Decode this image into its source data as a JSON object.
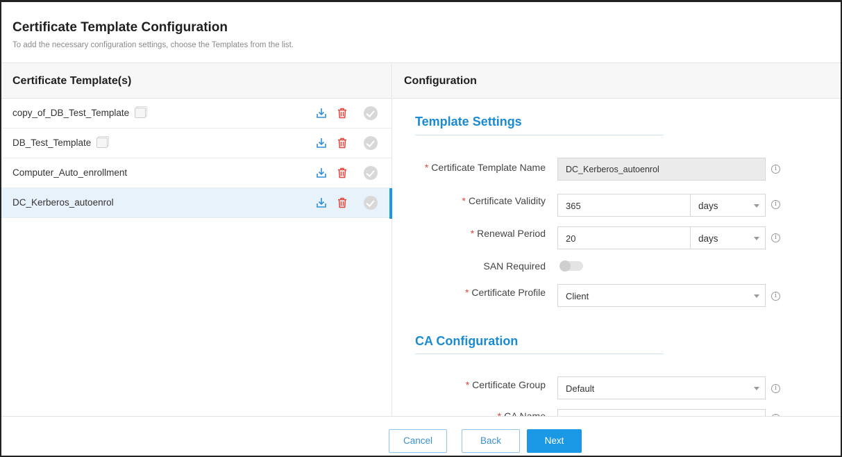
{
  "header": {
    "title": "Certificate Template Configuration",
    "subtitle": "To add the necessary configuration settings, choose the Templates from the list."
  },
  "template_list": {
    "heading": "Certificate Template(s)",
    "items": [
      {
        "name": "copy_of_DB_Test_Template",
        "has_copy_icon": true,
        "selected": false
      },
      {
        "name": "DB_Test_Template",
        "has_copy_icon": true,
        "selected": false
      },
      {
        "name": "Computer_Auto_enrollment",
        "has_copy_icon": false,
        "selected": false
      },
      {
        "name": "DC_Kerberos_autoenrol",
        "has_copy_icon": false,
        "selected": true
      }
    ],
    "row_icons": [
      "download-icon",
      "delete-icon",
      "check-circle-icon"
    ]
  },
  "configuration": {
    "heading": "Configuration",
    "template_settings": {
      "title": "Template Settings",
      "template_name_label": "Certificate Template Name",
      "template_name_value": "DC_Kerberos_autoenrol",
      "validity_label": "Certificate Validity",
      "validity_value": "365",
      "validity_unit": "days",
      "renewal_label": "Renewal Period",
      "renewal_value": "20",
      "renewal_unit": "days",
      "san_label": "SAN Required",
      "san_enabled": false,
      "profile_label": "Certificate Profile",
      "profile_value": "Client"
    },
    "ca_configuration": {
      "title": "CA Configuration",
      "group_label": "Certificate Group",
      "group_value": "Default",
      "ca_name_label": "CA Name"
    }
  },
  "footer": {
    "cancel_label": "Cancel",
    "back_label": "Back",
    "next_label": "Next"
  },
  "colors": {
    "accent": "#1a98e6",
    "section_title": "#1a8bd1",
    "delete_icon": "#e0463a",
    "required_star": "#e0463a",
    "selected_row_bg": "#e8f2fb"
  }
}
